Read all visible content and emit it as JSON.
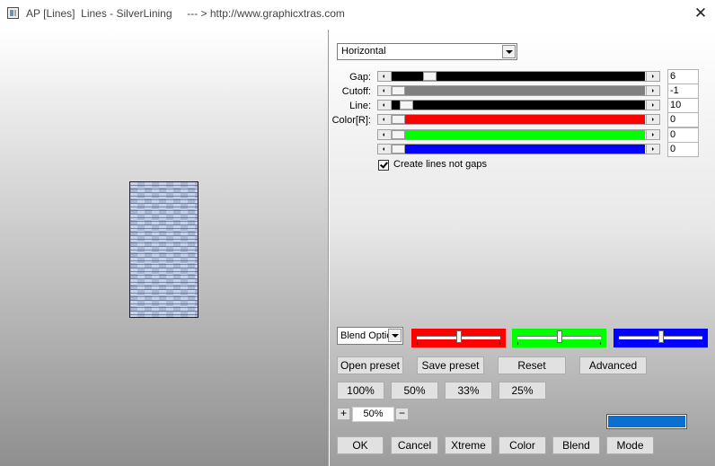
{
  "window": {
    "title": "AP [Lines]  Lines - SilverLining     --- > http://www.graphicxtras.com",
    "icon": "app-icon",
    "close_glyph": "✕"
  },
  "direction": {
    "selected": "Horizontal"
  },
  "sliders": [
    {
      "label": "Gap:",
      "value": "6",
      "fill": "#000000",
      "thumb": 0.13
    },
    {
      "label": "Cutoff:",
      "value": "-1",
      "fill": "#808080",
      "thumb": 0.0
    },
    {
      "label": "Line:",
      "value": "10",
      "fill": "#000000",
      "thumb": 0.035
    },
    {
      "label": "Color[R]:",
      "value": "0",
      "fill": "#ff0000",
      "thumb": 0.0
    },
    {
      "label": "",
      "value": "0",
      "fill": "#00ff00",
      "thumb": 0.0
    },
    {
      "label": "",
      "value": "0",
      "fill": "#0000ff",
      "thumb": 0.0
    }
  ],
  "option": {
    "label": "Create lines not gaps",
    "checked": true
  },
  "blend": {
    "selected": "Blend Options",
    "channels": [
      {
        "color": "#ff0000",
        "level": 0.5
      },
      {
        "color": "#00ff00",
        "level": 0.5
      },
      {
        "color": "#0000ff",
        "level": 0.5
      }
    ]
  },
  "buttons": {
    "open_preset": "Open preset",
    "save_preset": "Save preset",
    "reset": "Reset",
    "advanced": "Advanced",
    "zoom_100": "100%",
    "zoom_50": "50%",
    "zoom_33": "33%",
    "zoom_25": "25%",
    "zoom_plus": "+",
    "zoom_minus": "−",
    "ok": "OK",
    "cancel": "Cancel",
    "xtreme": "Xtreme",
    "color": "Color",
    "blend": "Blend",
    "mode": "Mode"
  },
  "zoom": {
    "value": "50%"
  },
  "color_swatch": "#0a6fd0"
}
